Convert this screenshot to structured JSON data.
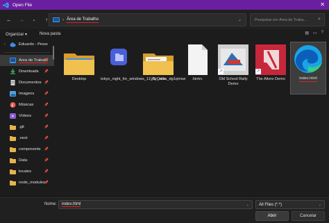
{
  "window": {
    "title": "Open File",
    "close_glyph": "✕"
  },
  "address": {
    "crumb": "Área de Trabalho"
  },
  "search": {
    "placeholder": "Pesquisar em Área de Traba..."
  },
  "toolbar": {
    "organize": "Organizar ▾",
    "new_folder": "Nova pasta"
  },
  "sidebar": {
    "items": [
      {
        "label": "Eduardo - Pessoal",
        "icon": "cloud-icon",
        "color": "#3b8ee6"
      },
      {
        "label": "Área de Trabalho",
        "icon": "desktop-icon",
        "color": "#3b8ee6"
      },
      {
        "label": "Downloads",
        "icon": "download-icon",
        "color": "#3bb36a"
      },
      {
        "label": "Documentos",
        "icon": "document-icon",
        "color": "#cfcfcf"
      },
      {
        "label": "Imagens",
        "icon": "image-icon",
        "color": "#4fa3e0"
      },
      {
        "label": "Músicas",
        "icon": "music-icon",
        "color": "#e25b4a"
      },
      {
        "label": "Vídeos",
        "icon": "video-icon",
        "color": "#8a5cd1"
      },
      {
        "label": ".git",
        "icon": "folder-icon",
        "color": "#e8b34a"
      },
      {
        "label": ".next",
        "icon": "folder-icon",
        "color": "#e8b34a"
      },
      {
        "label": "components",
        "icon": "folder-icon",
        "color": "#e8b34a"
      },
      {
        "label": "Data",
        "icon": "folder-icon",
        "color": "#e8b34a"
      },
      {
        "label": "locales",
        "icon": "folder-icon",
        "color": "#e8b34a"
      },
      {
        "label": "node_modules",
        "icon": "folder-icon",
        "color": "#e8b34a"
      }
    ]
  },
  "files": [
    {
      "name": "Desktop",
      "kind": "folder"
    },
    {
      "name": "tokyo_night_for_windows_11_by_niivu_dg1qmxw",
      "kind": "folder-app"
    },
    {
      "name": "VS Code",
      "kind": "folder-open"
    },
    {
      "name": ".hintrc",
      "kind": "file"
    },
    {
      "name": "Old School Rally Demo",
      "kind": "shortcut"
    },
    {
      "name": "The Alters Demo",
      "kind": "shortcut"
    },
    {
      "name": "index.html",
      "kind": "edge-html"
    }
  ],
  "footer": {
    "name_label": "Nome:",
    "filename": "index.html",
    "filter": "All Files (*.*)",
    "open": "Abrir",
    "cancel": "Cancelar"
  },
  "colors": {
    "titlebar": "#6a1fa0",
    "accent_underline": "#d22222",
    "folder": "#e8b34a"
  }
}
